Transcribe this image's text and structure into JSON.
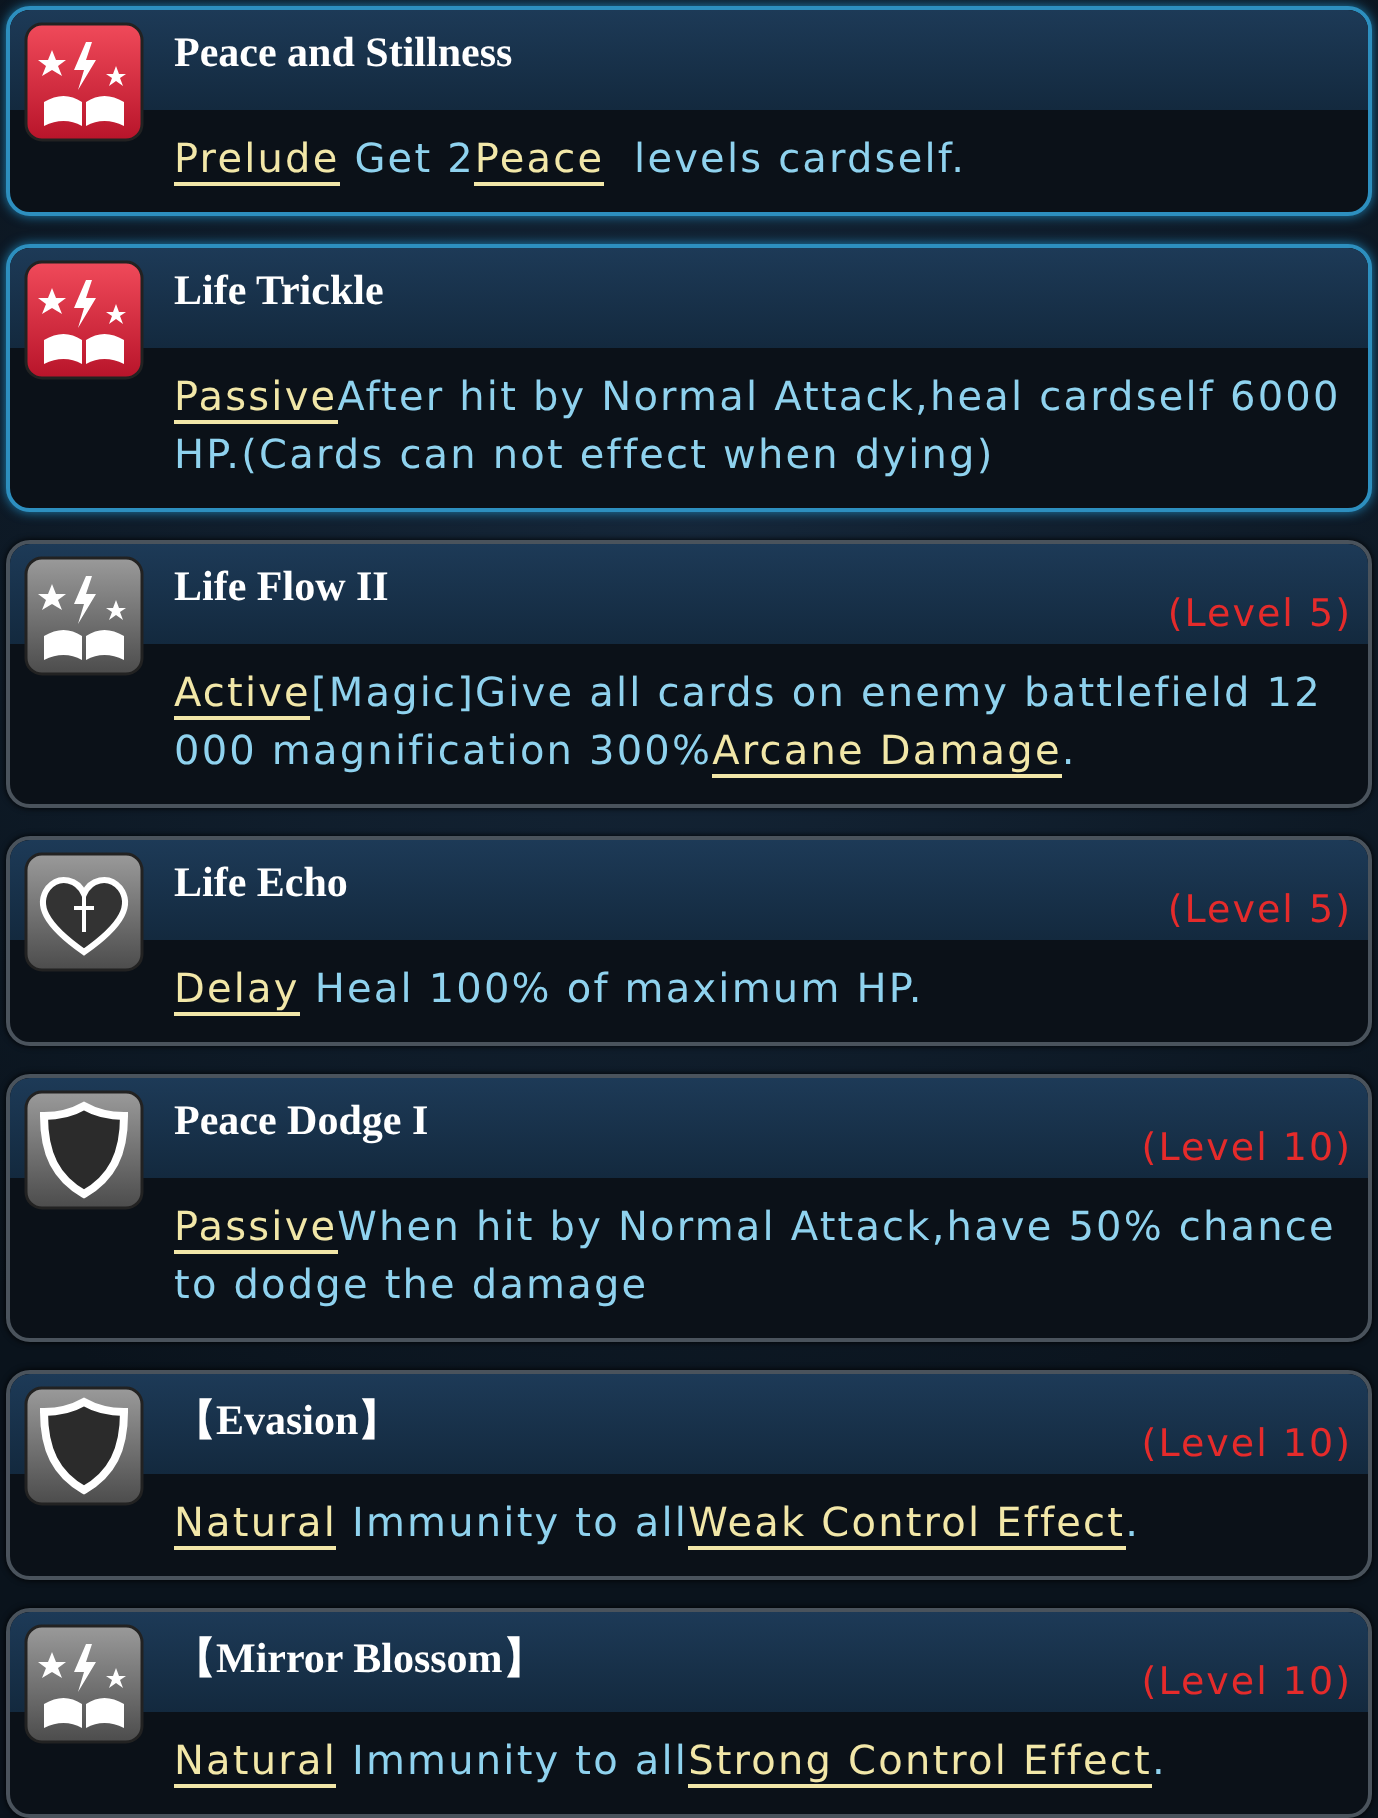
{
  "skills": [
    {
      "name": "Peace and Stillness",
      "kind": "book",
      "highlighted": true,
      "description": [
        {
          "kind": "keyword",
          "text": "Prelude"
        },
        {
          "kind": "text",
          "text": " Get 2"
        },
        {
          "kind": "keyword",
          "text": "Peace"
        },
        {
          "kind": "text",
          "text": "  levels cardself."
        }
      ]
    },
    {
      "name": "Life Trickle",
      "kind": "book",
      "highlighted": true,
      "description": [
        {
          "kind": "keyword",
          "text": "Passive"
        },
        {
          "kind": "text",
          "text": "After hit by Normal Attack,heal cardself 6000 HP.(Cards can not effect when dying)"
        }
      ]
    },
    {
      "name": "Life Flow II",
      "level": "(Level 5)",
      "kind": "book",
      "highlighted": false,
      "description": [
        {
          "kind": "keyword",
          "text": "Active"
        },
        {
          "kind": "text",
          "text": "[Magic]Give all cards on enemy battlefield 12000 magnification 300%"
        },
        {
          "kind": "keyword",
          "text": "Arcane Damage"
        },
        {
          "kind": "text",
          "text": "."
        }
      ]
    },
    {
      "name": "Life Echo",
      "level": "(Level 5)",
      "kind": "heart",
      "highlighted": false,
      "description": [
        {
          "kind": "keyword",
          "text": "Delay"
        },
        {
          "kind": "text",
          "text": " Heal 100% of maximum HP."
        }
      ]
    },
    {
      "name": "Peace Dodge I",
      "level": "(Level 10)",
      "kind": "shield",
      "highlighted": false,
      "description": [
        {
          "kind": "keyword",
          "text": "Passive"
        },
        {
          "kind": "text",
          "text": "When hit by Normal Attack,have 50% chance to dodge the damage"
        }
      ]
    },
    {
      "name": "【Evasion】",
      "level": "(Level 10)",
      "kind": "shield",
      "highlighted": false,
      "description": [
        {
          "kind": "keyword",
          "text": "Natural"
        },
        {
          "kind": "text",
          "text": " Immunity to all"
        },
        {
          "kind": "keyword",
          "text": "Weak Control Effect"
        },
        {
          "kind": "text",
          "text": "."
        }
      ]
    },
    {
      "name": "【Mirror Blossom】",
      "level": "(Level 10)",
      "kind": "book",
      "highlighted": false,
      "description": [
        {
          "kind": "keyword",
          "text": "Natural"
        },
        {
          "kind": "text",
          "text": " Immunity to all"
        },
        {
          "kind": "keyword",
          "text": "Strong Control Effect"
        },
        {
          "kind": "text",
          "text": "."
        }
      ]
    }
  ]
}
